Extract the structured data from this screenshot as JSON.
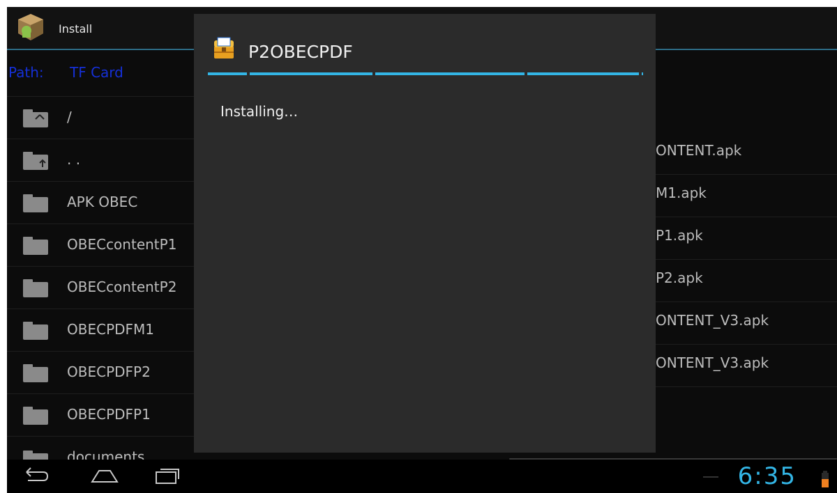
{
  "app": {
    "title": "Install"
  },
  "path_bar": {
    "label": "Path:",
    "value": "TF Card"
  },
  "folders": [
    {
      "label": "/"
    },
    {
      "label": ". ."
    },
    {
      "label": "APK OBEC"
    },
    {
      "label": "OBECcontentP1"
    },
    {
      "label": "OBECcontentP2"
    },
    {
      "label": "OBECPDFM1"
    },
    {
      "label": "OBECPDFP2"
    },
    {
      "label": "OBECPDFP1"
    },
    {
      "label": "documents"
    }
  ],
  "files": [
    {
      "label": "ONTENT.apk"
    },
    {
      "label": "M1.apk"
    },
    {
      "label": "P1.apk"
    },
    {
      "label": "P2.apk"
    },
    {
      "label": "ONTENT_V3.apk"
    },
    {
      "label": "ONTENT_V3.apk"
    }
  ],
  "dialog": {
    "title": "P2OBECPDF",
    "message": "Installing…"
  },
  "status": {
    "time": "6:35"
  },
  "colors": {
    "accent": "#33b5e5",
    "path_text": "#1530d8",
    "dialog_bg": "#2b2b2b"
  },
  "icons": {
    "app": "android-package-icon",
    "dialog": "treasure-chest-icon",
    "folder": "folder-icon",
    "back": "back-icon",
    "home": "home-icon",
    "recents": "recent-apps-icon",
    "battery": "battery-icon"
  }
}
